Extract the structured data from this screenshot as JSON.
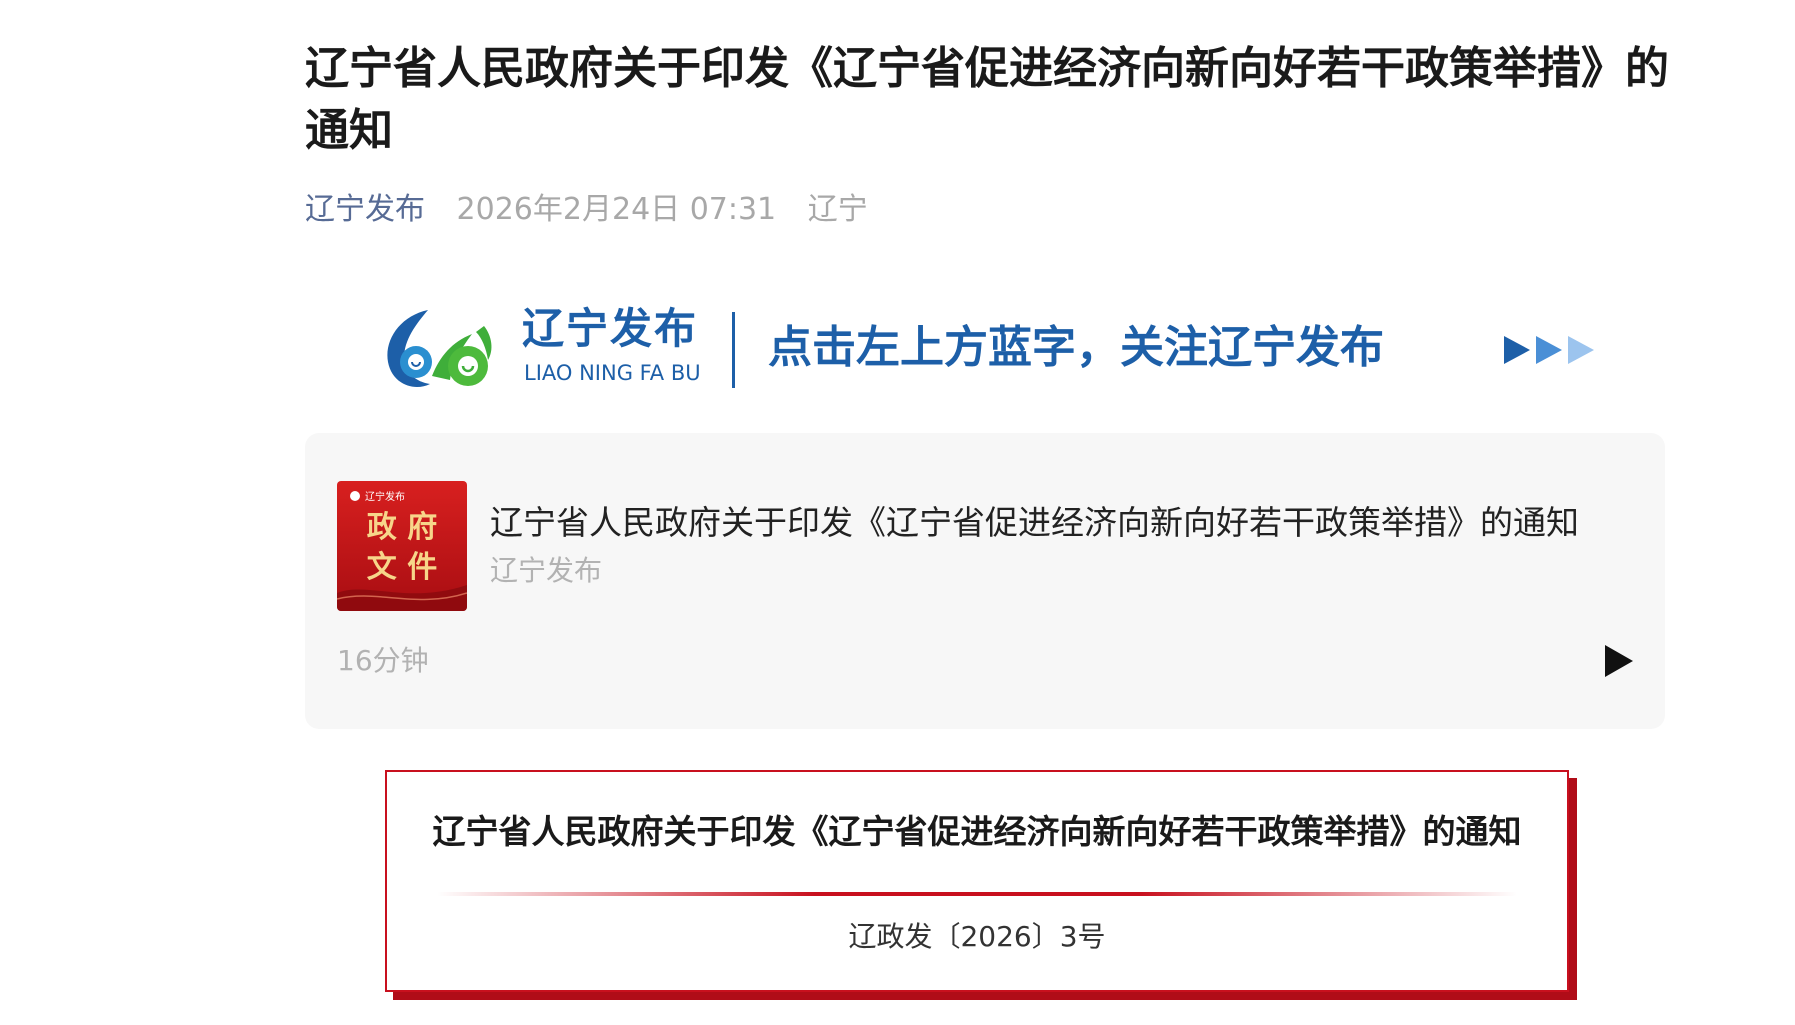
{
  "article": {
    "title": "辽宁省人民政府关于印发《辽宁省促进经济向新向好若干政策举措》的通知",
    "account": "辽宁发布",
    "date": "2026年2月24日 07:31",
    "location": "辽宁"
  },
  "banner": {
    "brand_cn": "辽宁发布",
    "brand_en": "LIAO NING FA BU",
    "cta": "点击左上方蓝字，关注辽宁发布",
    "accent_color": "#1d5fa8",
    "icon": "arrow-triple-icon"
  },
  "audio": {
    "cover": {
      "brand": "辽宁发布",
      "line1": "政 府",
      "line2": "文 件"
    },
    "title": "辽宁省人民政府关于印发《辽宁省促进经济向新向好若干政策举措》的通知",
    "author": "辽宁发布",
    "duration": "16分钟",
    "icon": "play-icon"
  },
  "document": {
    "title": "辽宁省人民政府关于印发《辽宁省促进经济向新向好若干政策举措》的通知",
    "number": "辽政发〔2026〕3号",
    "accent_color": "#c8101e"
  }
}
